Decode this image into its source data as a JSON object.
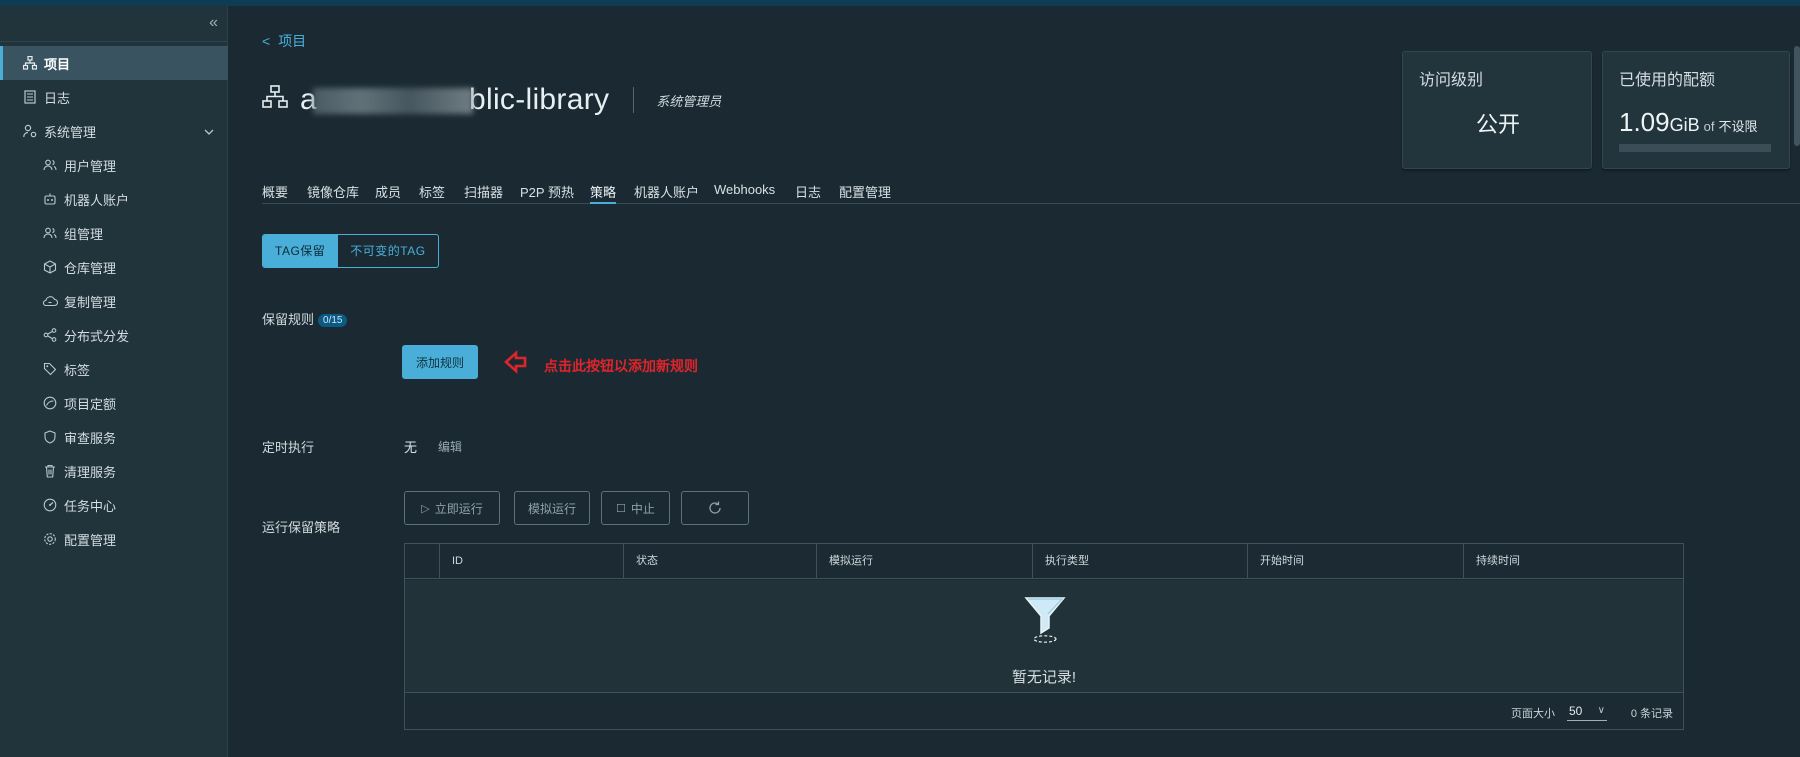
{
  "sidebar": {
    "collapse_glyph": "«",
    "items": [
      {
        "label": "项目",
        "icon": "projects-icon",
        "active": true
      },
      {
        "label": "日志",
        "icon": "logs-icon"
      },
      {
        "label": "系统管理",
        "icon": "admin-icon",
        "expanded": true
      }
    ],
    "sub_items": [
      {
        "label": "用户管理",
        "icon": "users-icon"
      },
      {
        "label": "机器人账户",
        "icon": "robot-icon"
      },
      {
        "label": "组管理",
        "icon": "groups-icon"
      },
      {
        "label": "仓库管理",
        "icon": "registry-icon"
      },
      {
        "label": "复制管理",
        "icon": "replication-icon"
      },
      {
        "label": "分布式分发",
        "icon": "distribution-icon"
      },
      {
        "label": "标签",
        "icon": "tag-icon"
      },
      {
        "label": "项目定额",
        "icon": "quota-icon"
      },
      {
        "label": "审查服务",
        "icon": "interrogation-icon"
      },
      {
        "label": "清理服务",
        "icon": "cleanup-icon"
      },
      {
        "label": "任务中心",
        "icon": "task-icon"
      },
      {
        "label": "配置管理",
        "icon": "config-icon"
      }
    ]
  },
  "header": {
    "back_label": "项目",
    "project_name_prefix": "a",
    "project_name_suffix": "blic-library",
    "role": "系统管理员"
  },
  "cards": {
    "access_label": "访问级别",
    "access_value": "公开",
    "quota_label": "已使用的配额",
    "quota_value": "1.09",
    "quota_unit": "GiB",
    "quota_of": "of",
    "quota_limit": "不设限",
    "quota_used_fraction": 0.0
  },
  "tabs": [
    {
      "label": "概要"
    },
    {
      "label": "镜像仓库"
    },
    {
      "label": "成员"
    },
    {
      "label": "标签"
    },
    {
      "label": "扫描器"
    },
    {
      "label": "P2P 预热"
    },
    {
      "label": "策略",
      "active": true
    },
    {
      "label": "机器人账户"
    },
    {
      "label": "Webhooks"
    },
    {
      "label": "日志"
    },
    {
      "label": "配置管理"
    }
  ],
  "policy_tabs": {
    "retention": "TAG保留",
    "immutable": "不可变的TAG"
  },
  "retention": {
    "rules_label": "保留规则",
    "rules_count": "0/15",
    "add_rule": "添加规则",
    "annotation": "点击此按钮以添加新规则",
    "schedule_label": "定时执行",
    "schedule_value": "无",
    "schedule_edit": "编辑",
    "run_label": "运行保留策略",
    "run_now": "立即运行",
    "dry_run": "模拟运行",
    "abort": "中止"
  },
  "grid": {
    "columns": [
      "ID",
      "状态",
      "模拟运行",
      "执行类型",
      "开始时间",
      "持续时间"
    ],
    "empty_text": "暂无记录!",
    "page_size_label": "页面大小",
    "page_size": "50",
    "record_count": "0 条记录"
  },
  "colors": {
    "accent": "#49afd9",
    "background": "#1b2a32",
    "sidebar": "#21333b",
    "annotation": "#e0242b"
  }
}
